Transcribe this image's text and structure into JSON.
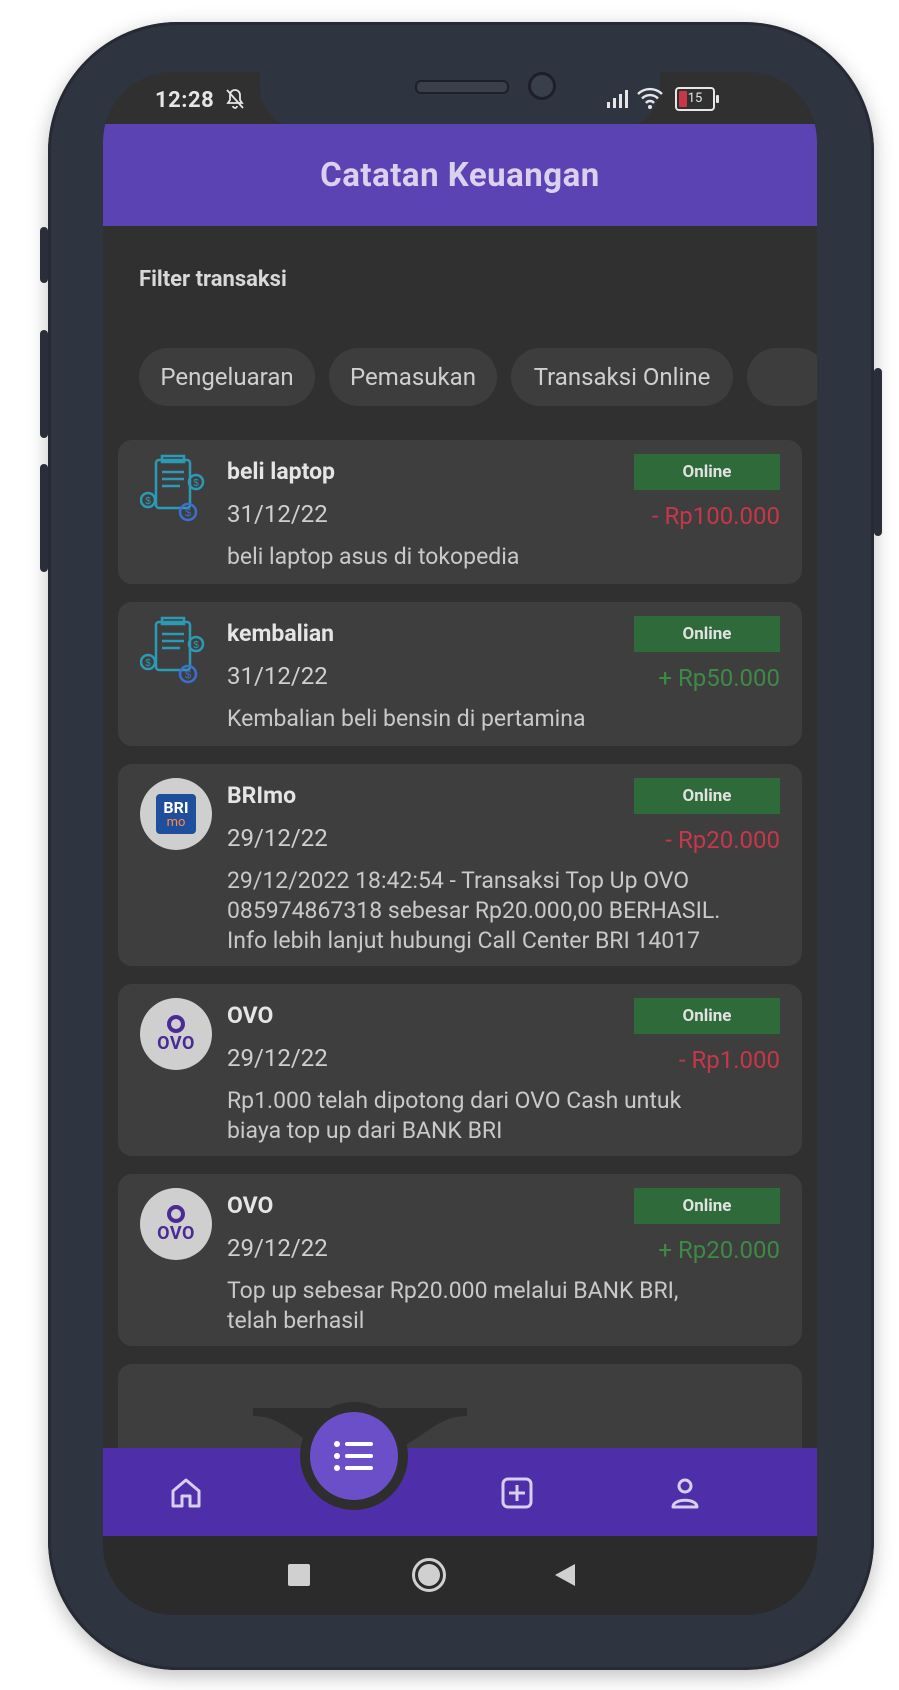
{
  "status_bar": {
    "time": "12:28",
    "battery": "15"
  },
  "app_bar": {
    "title": "Catatan Keuangan"
  },
  "filter": {
    "label": "Filter transaksi",
    "chips": [
      "Pengeluaran",
      "Pemasukan",
      "Transaksi Online"
    ]
  },
  "transactions": [
    {
      "title": "beli laptop",
      "date": "31/12/22",
      "badge": "Online",
      "amount": "- Rp100.000",
      "type": "expense",
      "icon": "finance-document-icon",
      "description": "beli laptop  asus di tokopedia"
    },
    {
      "title": "kembalian",
      "date": "31/12/22",
      "badge": "Online",
      "amount": "+ Rp50.000",
      "type": "income",
      "icon": "finance-document-icon",
      "description": "Kembalian beli bensin di pertamina"
    },
    {
      "title": "BRImo",
      "date": "29/12/22",
      "badge": "Online",
      "amount": "- Rp20.000",
      "type": "expense",
      "icon": "brimo-logo",
      "description": "29/12/2022 18:42:54 - Transaksi Top Up OVO\n085974867318 sebesar Rp20.000,00 BERHASIL.\nInfo lebih lanjut hubungi Call Center BRI 14017",
      "logo_text": "BRI",
      "logo_subtext": "mo"
    },
    {
      "title": "OVO",
      "date": "29/12/22",
      "badge": "Online",
      "amount": "- Rp1.000",
      "type": "expense",
      "icon": "ovo-logo",
      "description": "Rp1.000 telah dipotong dari OVO Cash untuk\nbiaya top up dari BANK BRI",
      "logo_text": "OVO"
    },
    {
      "title": "OVO",
      "date": "29/12/22",
      "badge": "Online",
      "amount": "+ Rp20.000",
      "type": "income",
      "icon": "ovo-logo",
      "description": "Top up sebesar Rp20.000 melalui BANK BRI,\ntelah berhasil",
      "logo_text": "OVO"
    }
  ],
  "bottom_nav": {
    "items": [
      "home-icon",
      "list-icon",
      "add-icon",
      "profile-icon"
    ],
    "active": "list-icon"
  },
  "colors": {
    "app_bar": "#5c43b4",
    "bottom_bar": "#4e2fa9",
    "fab": "#6b4fc8",
    "badge": "#2e6a3a",
    "expense": "#c8364a",
    "income": "#3d8a45"
  }
}
